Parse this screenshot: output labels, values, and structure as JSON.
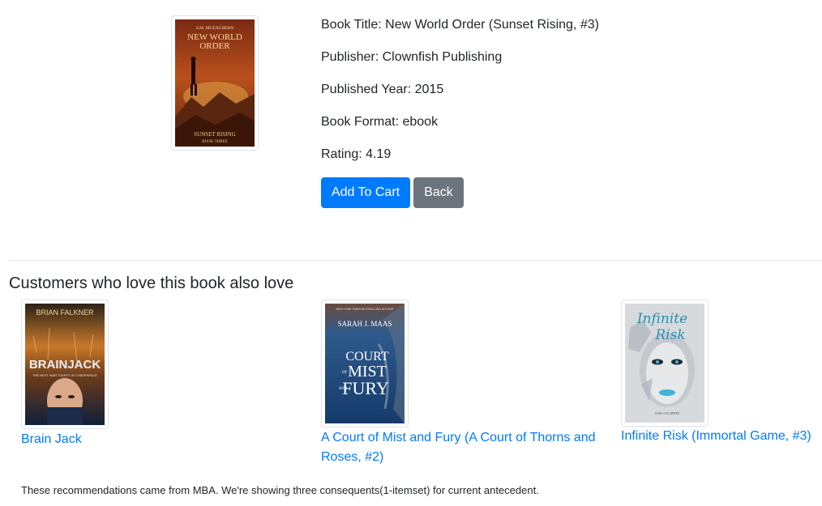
{
  "book": {
    "cover": {
      "author": "S.M. MCEACHERN",
      "title_line1": "NEW WORLD",
      "title_line2": "ORDER",
      "series_line1": "SUNSET RISING",
      "series_line2": "BOOK THREE"
    },
    "title_line": "Book Title: New World Order (Sunset Rising, #3)",
    "publisher_line": "Publisher: Clownfish Publishing",
    "year_line": "Published Year: 2015",
    "format_line": "Book Format: ebook",
    "rating_line": "Rating: 4.19"
  },
  "actions": {
    "add_to_cart_label": "Add To Cart",
    "back_label": "Back"
  },
  "recommendations": {
    "heading": "Customers who love this book also love",
    "items": [
      {
        "title": "Brain Jack",
        "cover": {
          "author": "BRIAN FALKNER",
          "title": "BRAINJACK",
          "tagline": "THE NEXT WAR STARTS IN CYBERSPACE"
        }
      },
      {
        "title": "A Court of Mist and Fury (A Court of Thorns and Roses, #2)",
        "cover": {
          "tag": "NEW YORK TIMES BESTSELLING AUTHOR",
          "author": "SARAH J. MAAS",
          "line1": "COURT",
          "line2": "MIST",
          "line3": "FURY",
          "of": "OF",
          "and": "AND"
        }
      },
      {
        "title": "Infinite Risk (Immortal Game, #3)",
        "cover": {
          "line1": "Infinite",
          "line2": "Risk",
          "author": "ANN AGUIRRE"
        }
      }
    ],
    "footnote": "These recommendations came from MBA. We're showing three consequents(1-itemset) for current antecedent."
  },
  "colors": {
    "primary": "#007bff",
    "secondary": "#6c757d",
    "link": "#007bff",
    "text": "#212529"
  }
}
